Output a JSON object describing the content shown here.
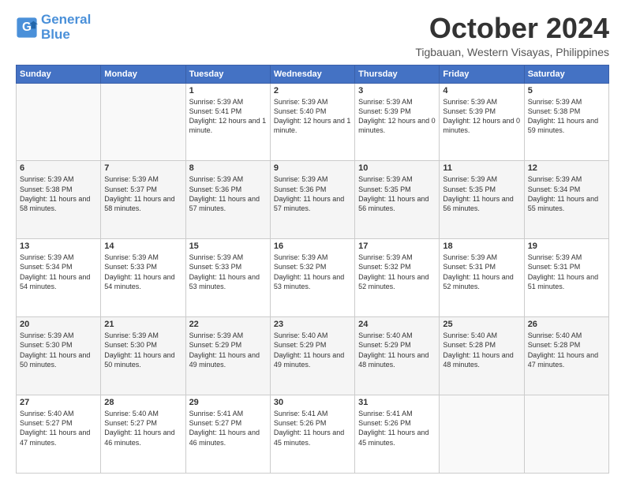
{
  "logo": {
    "line1": "General",
    "line2": "Blue"
  },
  "title": "October 2024",
  "location": "Tigbauan, Western Visayas, Philippines",
  "days_header": [
    "Sunday",
    "Monday",
    "Tuesday",
    "Wednesday",
    "Thursday",
    "Friday",
    "Saturday"
  ],
  "weeks": [
    [
      {
        "day": "",
        "info": ""
      },
      {
        "day": "",
        "info": ""
      },
      {
        "day": "1",
        "info": "Sunrise: 5:39 AM\nSunset: 5:41 PM\nDaylight: 12 hours\nand 1 minute."
      },
      {
        "day": "2",
        "info": "Sunrise: 5:39 AM\nSunset: 5:40 PM\nDaylight: 12 hours\nand 1 minute."
      },
      {
        "day": "3",
        "info": "Sunrise: 5:39 AM\nSunset: 5:39 PM\nDaylight: 12 hours\nand 0 minutes."
      },
      {
        "day": "4",
        "info": "Sunrise: 5:39 AM\nSunset: 5:39 PM\nDaylight: 12 hours\nand 0 minutes."
      },
      {
        "day": "5",
        "info": "Sunrise: 5:39 AM\nSunset: 5:38 PM\nDaylight: 11 hours\nand 59 minutes."
      }
    ],
    [
      {
        "day": "6",
        "info": "Sunrise: 5:39 AM\nSunset: 5:38 PM\nDaylight: 11 hours\nand 58 minutes."
      },
      {
        "day": "7",
        "info": "Sunrise: 5:39 AM\nSunset: 5:37 PM\nDaylight: 11 hours\nand 58 minutes."
      },
      {
        "day": "8",
        "info": "Sunrise: 5:39 AM\nSunset: 5:36 PM\nDaylight: 11 hours\nand 57 minutes."
      },
      {
        "day": "9",
        "info": "Sunrise: 5:39 AM\nSunset: 5:36 PM\nDaylight: 11 hours\nand 57 minutes."
      },
      {
        "day": "10",
        "info": "Sunrise: 5:39 AM\nSunset: 5:35 PM\nDaylight: 11 hours\nand 56 minutes."
      },
      {
        "day": "11",
        "info": "Sunrise: 5:39 AM\nSunset: 5:35 PM\nDaylight: 11 hours\nand 56 minutes."
      },
      {
        "day": "12",
        "info": "Sunrise: 5:39 AM\nSunset: 5:34 PM\nDaylight: 11 hours\nand 55 minutes."
      }
    ],
    [
      {
        "day": "13",
        "info": "Sunrise: 5:39 AM\nSunset: 5:34 PM\nDaylight: 11 hours\nand 54 minutes."
      },
      {
        "day": "14",
        "info": "Sunrise: 5:39 AM\nSunset: 5:33 PM\nDaylight: 11 hours\nand 54 minutes."
      },
      {
        "day": "15",
        "info": "Sunrise: 5:39 AM\nSunset: 5:33 PM\nDaylight: 11 hours\nand 53 minutes."
      },
      {
        "day": "16",
        "info": "Sunrise: 5:39 AM\nSunset: 5:32 PM\nDaylight: 11 hours\nand 53 minutes."
      },
      {
        "day": "17",
        "info": "Sunrise: 5:39 AM\nSunset: 5:32 PM\nDaylight: 11 hours\nand 52 minutes."
      },
      {
        "day": "18",
        "info": "Sunrise: 5:39 AM\nSunset: 5:31 PM\nDaylight: 11 hours\nand 52 minutes."
      },
      {
        "day": "19",
        "info": "Sunrise: 5:39 AM\nSunset: 5:31 PM\nDaylight: 11 hours\nand 51 minutes."
      }
    ],
    [
      {
        "day": "20",
        "info": "Sunrise: 5:39 AM\nSunset: 5:30 PM\nDaylight: 11 hours\nand 50 minutes."
      },
      {
        "day": "21",
        "info": "Sunrise: 5:39 AM\nSunset: 5:30 PM\nDaylight: 11 hours\nand 50 minutes."
      },
      {
        "day": "22",
        "info": "Sunrise: 5:39 AM\nSunset: 5:29 PM\nDaylight: 11 hours\nand 49 minutes."
      },
      {
        "day": "23",
        "info": "Sunrise: 5:40 AM\nSunset: 5:29 PM\nDaylight: 11 hours\nand 49 minutes."
      },
      {
        "day": "24",
        "info": "Sunrise: 5:40 AM\nSunset: 5:29 PM\nDaylight: 11 hours\nand 48 minutes."
      },
      {
        "day": "25",
        "info": "Sunrise: 5:40 AM\nSunset: 5:28 PM\nDaylight: 11 hours\nand 48 minutes."
      },
      {
        "day": "26",
        "info": "Sunrise: 5:40 AM\nSunset: 5:28 PM\nDaylight: 11 hours\nand 47 minutes."
      }
    ],
    [
      {
        "day": "27",
        "info": "Sunrise: 5:40 AM\nSunset: 5:27 PM\nDaylight: 11 hours\nand 47 minutes."
      },
      {
        "day": "28",
        "info": "Sunrise: 5:40 AM\nSunset: 5:27 PM\nDaylight: 11 hours\nand 46 minutes."
      },
      {
        "day": "29",
        "info": "Sunrise: 5:41 AM\nSunset: 5:27 PM\nDaylight: 11 hours\nand 46 minutes."
      },
      {
        "day": "30",
        "info": "Sunrise: 5:41 AM\nSunset: 5:26 PM\nDaylight: 11 hours\nand 45 minutes."
      },
      {
        "day": "31",
        "info": "Sunrise: 5:41 AM\nSunset: 5:26 PM\nDaylight: 11 hours\nand 45 minutes."
      },
      {
        "day": "",
        "info": ""
      },
      {
        "day": "",
        "info": ""
      }
    ]
  ]
}
